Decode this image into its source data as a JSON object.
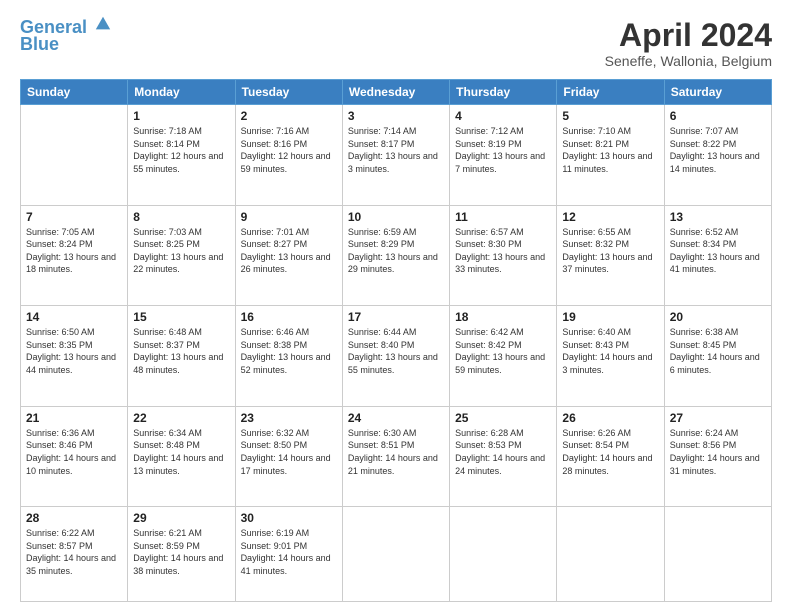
{
  "header": {
    "logo_line1": "General",
    "logo_line2": "Blue",
    "month_title": "April 2024",
    "subtitle": "Seneffe, Wallonia, Belgium"
  },
  "weekdays": [
    "Sunday",
    "Monday",
    "Tuesday",
    "Wednesday",
    "Thursday",
    "Friday",
    "Saturday"
  ],
  "weeks": [
    [
      {
        "day": "",
        "sunrise": "",
        "sunset": "",
        "daylight": ""
      },
      {
        "day": "1",
        "sunrise": "Sunrise: 7:18 AM",
        "sunset": "Sunset: 8:14 PM",
        "daylight": "Daylight: 12 hours and 55 minutes."
      },
      {
        "day": "2",
        "sunrise": "Sunrise: 7:16 AM",
        "sunset": "Sunset: 8:16 PM",
        "daylight": "Daylight: 12 hours and 59 minutes."
      },
      {
        "day": "3",
        "sunrise": "Sunrise: 7:14 AM",
        "sunset": "Sunset: 8:17 PM",
        "daylight": "Daylight: 13 hours and 3 minutes."
      },
      {
        "day": "4",
        "sunrise": "Sunrise: 7:12 AM",
        "sunset": "Sunset: 8:19 PM",
        "daylight": "Daylight: 13 hours and 7 minutes."
      },
      {
        "day": "5",
        "sunrise": "Sunrise: 7:10 AM",
        "sunset": "Sunset: 8:21 PM",
        "daylight": "Daylight: 13 hours and 11 minutes."
      },
      {
        "day": "6",
        "sunrise": "Sunrise: 7:07 AM",
        "sunset": "Sunset: 8:22 PM",
        "daylight": "Daylight: 13 hours and 14 minutes."
      }
    ],
    [
      {
        "day": "7",
        "sunrise": "Sunrise: 7:05 AM",
        "sunset": "Sunset: 8:24 PM",
        "daylight": "Daylight: 13 hours and 18 minutes."
      },
      {
        "day": "8",
        "sunrise": "Sunrise: 7:03 AM",
        "sunset": "Sunset: 8:25 PM",
        "daylight": "Daylight: 13 hours and 22 minutes."
      },
      {
        "day": "9",
        "sunrise": "Sunrise: 7:01 AM",
        "sunset": "Sunset: 8:27 PM",
        "daylight": "Daylight: 13 hours and 26 minutes."
      },
      {
        "day": "10",
        "sunrise": "Sunrise: 6:59 AM",
        "sunset": "Sunset: 8:29 PM",
        "daylight": "Daylight: 13 hours and 29 minutes."
      },
      {
        "day": "11",
        "sunrise": "Sunrise: 6:57 AM",
        "sunset": "Sunset: 8:30 PM",
        "daylight": "Daylight: 13 hours and 33 minutes."
      },
      {
        "day": "12",
        "sunrise": "Sunrise: 6:55 AM",
        "sunset": "Sunset: 8:32 PM",
        "daylight": "Daylight: 13 hours and 37 minutes."
      },
      {
        "day": "13",
        "sunrise": "Sunrise: 6:52 AM",
        "sunset": "Sunset: 8:34 PM",
        "daylight": "Daylight: 13 hours and 41 minutes."
      }
    ],
    [
      {
        "day": "14",
        "sunrise": "Sunrise: 6:50 AM",
        "sunset": "Sunset: 8:35 PM",
        "daylight": "Daylight: 13 hours and 44 minutes."
      },
      {
        "day": "15",
        "sunrise": "Sunrise: 6:48 AM",
        "sunset": "Sunset: 8:37 PM",
        "daylight": "Daylight: 13 hours and 48 minutes."
      },
      {
        "day": "16",
        "sunrise": "Sunrise: 6:46 AM",
        "sunset": "Sunset: 8:38 PM",
        "daylight": "Daylight: 13 hours and 52 minutes."
      },
      {
        "day": "17",
        "sunrise": "Sunrise: 6:44 AM",
        "sunset": "Sunset: 8:40 PM",
        "daylight": "Daylight: 13 hours and 55 minutes."
      },
      {
        "day": "18",
        "sunrise": "Sunrise: 6:42 AM",
        "sunset": "Sunset: 8:42 PM",
        "daylight": "Daylight: 13 hours and 59 minutes."
      },
      {
        "day": "19",
        "sunrise": "Sunrise: 6:40 AM",
        "sunset": "Sunset: 8:43 PM",
        "daylight": "Daylight: 14 hours and 3 minutes."
      },
      {
        "day": "20",
        "sunrise": "Sunrise: 6:38 AM",
        "sunset": "Sunset: 8:45 PM",
        "daylight": "Daylight: 14 hours and 6 minutes."
      }
    ],
    [
      {
        "day": "21",
        "sunrise": "Sunrise: 6:36 AM",
        "sunset": "Sunset: 8:46 PM",
        "daylight": "Daylight: 14 hours and 10 minutes."
      },
      {
        "day": "22",
        "sunrise": "Sunrise: 6:34 AM",
        "sunset": "Sunset: 8:48 PM",
        "daylight": "Daylight: 14 hours and 13 minutes."
      },
      {
        "day": "23",
        "sunrise": "Sunrise: 6:32 AM",
        "sunset": "Sunset: 8:50 PM",
        "daylight": "Daylight: 14 hours and 17 minutes."
      },
      {
        "day": "24",
        "sunrise": "Sunrise: 6:30 AM",
        "sunset": "Sunset: 8:51 PM",
        "daylight": "Daylight: 14 hours and 21 minutes."
      },
      {
        "day": "25",
        "sunrise": "Sunrise: 6:28 AM",
        "sunset": "Sunset: 8:53 PM",
        "daylight": "Daylight: 14 hours and 24 minutes."
      },
      {
        "day": "26",
        "sunrise": "Sunrise: 6:26 AM",
        "sunset": "Sunset: 8:54 PM",
        "daylight": "Daylight: 14 hours and 28 minutes."
      },
      {
        "day": "27",
        "sunrise": "Sunrise: 6:24 AM",
        "sunset": "Sunset: 8:56 PM",
        "daylight": "Daylight: 14 hours and 31 minutes."
      }
    ],
    [
      {
        "day": "28",
        "sunrise": "Sunrise: 6:22 AM",
        "sunset": "Sunset: 8:57 PM",
        "daylight": "Daylight: 14 hours and 35 minutes."
      },
      {
        "day": "29",
        "sunrise": "Sunrise: 6:21 AM",
        "sunset": "Sunset: 8:59 PM",
        "daylight": "Daylight: 14 hours and 38 minutes."
      },
      {
        "day": "30",
        "sunrise": "Sunrise: 6:19 AM",
        "sunset": "Sunset: 9:01 PM",
        "daylight": "Daylight: 14 hours and 41 minutes."
      },
      {
        "day": "",
        "sunrise": "",
        "sunset": "",
        "daylight": ""
      },
      {
        "day": "",
        "sunrise": "",
        "sunset": "",
        "daylight": ""
      },
      {
        "day": "",
        "sunrise": "",
        "sunset": "",
        "daylight": ""
      },
      {
        "day": "",
        "sunrise": "",
        "sunset": "",
        "daylight": ""
      }
    ]
  ]
}
